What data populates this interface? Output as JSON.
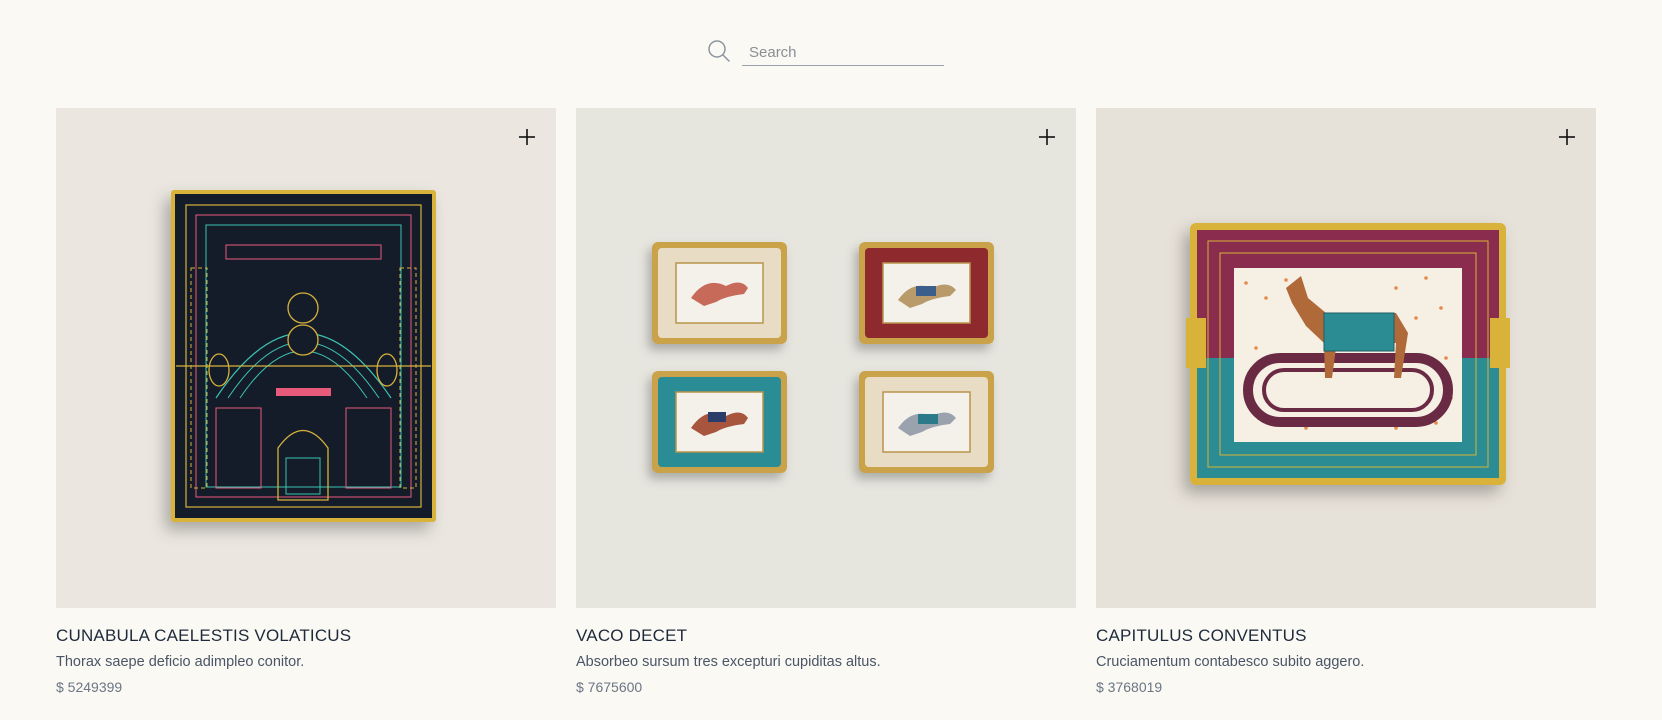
{
  "search": {
    "placeholder": "Search",
    "value": ""
  },
  "products": [
    {
      "name": "CUNABULA CAELESTIS VOLATICUS",
      "description": "Thorax saepe deficio adimpleo conitor.",
      "price": "$ 5249399",
      "image_icon": "geometric-ashtray-image",
      "background": "#ebe7e0"
    },
    {
      "name": "VACO DECET",
      "description": "Absorbeo sursum tres excepturi cupiditas altus.",
      "price": "$ 7675600",
      "image_icon": "four-horse-ashtrays-image",
      "background": "#e6e5de"
    },
    {
      "name": "CAPITULUS CONVENTUS",
      "description": "Cruciamentum contabesco subito aggero.",
      "price": "$ 3768019",
      "image_icon": "horse-racetrack-ashtray-image",
      "background": "#e7e2d9"
    }
  ],
  "colors": {
    "page_background": "#fbf9f3",
    "title_text": "#1e2a3c",
    "body_text": "#4a5567",
    "price_text": "#6b7685",
    "gold_rim": "#d9b23a"
  },
  "icons": {
    "search": "search-icon",
    "add": "plus-icon"
  }
}
